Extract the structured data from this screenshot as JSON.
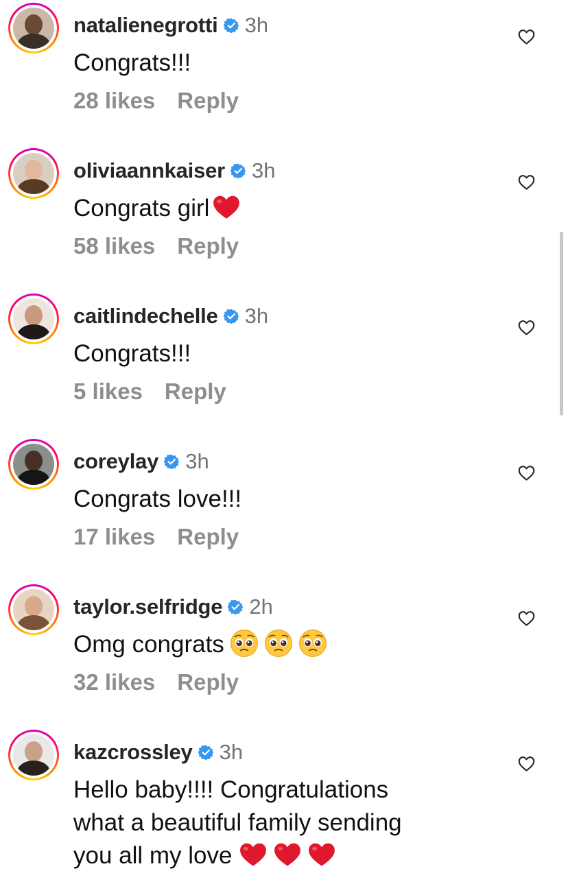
{
  "comments": [
    {
      "username": "natalienegrotti",
      "time": "3h",
      "lines": [
        "Congrats!!!"
      ],
      "emoji": "",
      "likes": "28 likes",
      "reply": "Reply",
      "avatar_colors": {
        "bg": "#c9b8a6",
        "skin": "#6b4a35",
        "top": "#3a2f28"
      }
    },
    {
      "username": "oliviaannkaiser",
      "time": "3h",
      "lines": [
        "Congrats girl"
      ],
      "emoji": "red-heart",
      "likes": "58 likes",
      "reply": "Reply",
      "avatar_colors": {
        "bg": "#d8cfc2",
        "skin": "#e2b79b",
        "top": "#5a3b22"
      }
    },
    {
      "username": "caitlindechelle",
      "time": "3h",
      "lines": [
        "Congrats!!!"
      ],
      "emoji": "",
      "likes": "5 likes",
      "reply": "Reply",
      "avatar_colors": {
        "bg": "#ece6df",
        "skin": "#c99a7d",
        "top": "#1f1a18"
      }
    },
    {
      "username": "coreylay",
      "time": "3h",
      "lines": [
        "Congrats love!!!"
      ],
      "emoji": "",
      "likes": "17 likes",
      "reply": "Reply",
      "avatar_colors": {
        "bg": "#8a8f8c",
        "skin": "#4a3024",
        "top": "#151515"
      }
    },
    {
      "username": "taylor.selfridge",
      "time": "2h",
      "lines": [
        "Omg congrats"
      ],
      "emoji": "pleading-face",
      "likes": "32 likes",
      "reply": "Reply",
      "avatar_colors": {
        "bg": "#e7d5c4",
        "skin": "#d9a98b",
        "top": "#7a5236"
      }
    },
    {
      "username": "kazcrossley",
      "time": "3h",
      "lines": [
        "Hello baby!!!! Congratulations",
        "what a beautiful family sending",
        "you all my love"
      ],
      "emoji": "red-heart",
      "likes": "",
      "reply": "",
      "avatar_colors": {
        "bg": "#e8e8e8",
        "skin": "#caa087",
        "top": "#2b211c"
      }
    }
  ],
  "colors": {
    "verified": "#3897f0",
    "heart_emoji": "#e0182d",
    "story_ring": "#d300c5"
  },
  "icons": {
    "verified": "verified-badge-icon",
    "like": "heart-outline-icon"
  }
}
